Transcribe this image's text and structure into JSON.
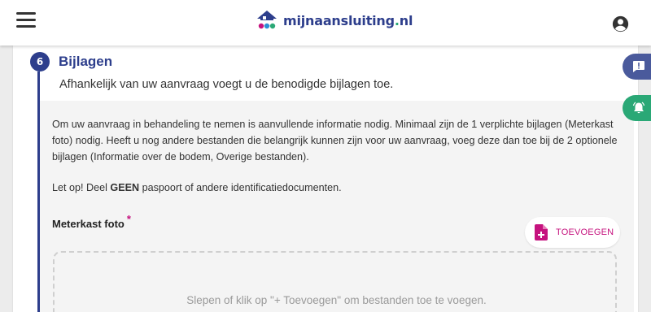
{
  "header": {
    "menu_icon": "hamburger-menu-icon",
    "logo_main": "mijnaansluiting",
    "logo_dot": ".",
    "logo_tld": "nl",
    "user_icon": "account-circle-icon",
    "brand_colors": {
      "blue": "#2d3e8c",
      "magenta": "#c5127e",
      "green": "#2aa876"
    }
  },
  "step": {
    "number": "6",
    "title": "Bijlagen",
    "subtitle": "Afhankelijk van uw aanvraag voegt u de benodigde bijlagen toe."
  },
  "info": {
    "paragraph": "Om uw aanvraag in behandeling te nemen is aanvullende informatie nodig. Minimaal zijn de 1 verplichte bijlagen (Meterkast foto) nodig. Heeft u nog andere bestanden die belangrijk kunnen zijn voor uw aanvraag, voeg deze dan toe bij de 2 optionele bijlagen (Informatie over de bodem, Overige bestanden).",
    "warning_prefix": "Let op! Deel ",
    "warning_bold": "GEEN",
    "warning_suffix": " paspoort of andere identificatiedocumenten."
  },
  "upload": {
    "label": "Meterkast foto",
    "required_marker": "*",
    "add_button": "TOEVOEGEN",
    "add_icon": "file-plus-icon",
    "dropzone_text": "Slepen of klik op \"+ Toevoegen\" om bestanden toe te voegen."
  },
  "side_tabs": {
    "feedback_icon": "feedback-chat-icon",
    "notify_icon": "notification-bell-icon"
  }
}
